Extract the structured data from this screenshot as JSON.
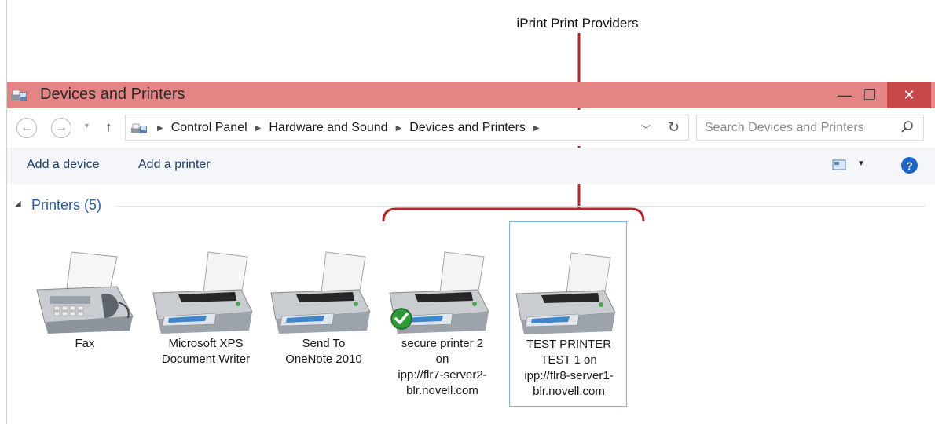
{
  "annotation": {
    "label": "iPrint Print Providers"
  },
  "window": {
    "title": "Devices and Printers",
    "controls": {
      "minimize": "—",
      "maximize": "❐",
      "close": "✕"
    }
  },
  "address": {
    "crumbs": [
      "Control Panel",
      "Hardware and Sound",
      "Devices and Printers"
    ]
  },
  "search": {
    "placeholder": "Search Devices and Printers"
  },
  "commands": {
    "add_device": "Add a device",
    "add_printer": "Add a printer",
    "help": "?"
  },
  "group": {
    "title": "Printers (5)"
  },
  "devices": [
    {
      "lines": [
        "Fax"
      ],
      "icon": "fax-icon"
    },
    {
      "lines": [
        "Microsoft XPS",
        "Document Writer"
      ],
      "icon": "printer-icon"
    },
    {
      "lines": [
        "Send To",
        "OneNote 2010"
      ],
      "icon": "printer-icon"
    },
    {
      "lines": [
        "secure printer 2",
        "on",
        "ipp://flr7-server2-",
        "blr.novell.com"
      ],
      "icon": "printer-icon",
      "default": true
    },
    {
      "lines": [
        "TEST PRINTER",
        "TEST 1 on",
        "ipp://flr8-server1-",
        "blr.novell.com"
      ],
      "icon": "printer-icon",
      "selected": true
    }
  ],
  "colors": {
    "titlebar": "#e58484",
    "close": "#c74848",
    "annotation": "#b6262e",
    "link": "#2a5aa0"
  }
}
